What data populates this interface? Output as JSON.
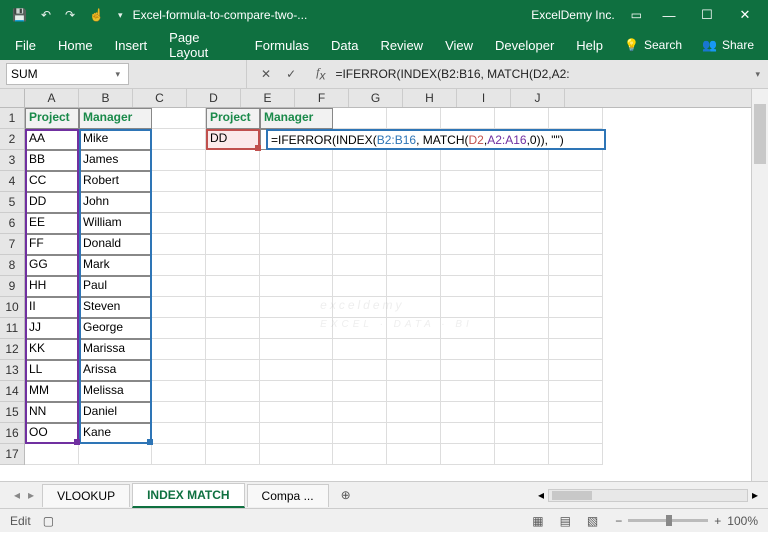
{
  "titlebar": {
    "filename": "Excel-formula-to-compare-two-...",
    "org": "ExcelDemy Inc.",
    "icons": [
      "save",
      "undo",
      "redo",
      "touch"
    ]
  },
  "ribbon": {
    "tabs": [
      "File",
      "Home",
      "Insert",
      "Page Layout",
      "Formulas",
      "Data",
      "Review",
      "View",
      "Developer",
      "Help"
    ],
    "search": "Search",
    "share": "Share"
  },
  "namebox": "SUM",
  "formula_bar": "=IFERROR(INDEX(B2:B16, MATCH(D2,A2:",
  "columns": [
    "A",
    "B",
    "C",
    "D",
    "E",
    "F",
    "G",
    "H",
    "I",
    "J"
  ],
  "rows": [
    1,
    2,
    3,
    4,
    5,
    6,
    7,
    8,
    9,
    10,
    11,
    12,
    13,
    14,
    15,
    16,
    17
  ],
  "headers": {
    "a1": "Project",
    "b1": "Manager",
    "d1": "Project",
    "e1": "Manager"
  },
  "data": {
    "col_a": [
      "AA",
      "BB",
      "CC",
      "DD",
      "EE",
      "FF",
      "GG",
      "HH",
      "II",
      "JJ",
      "KK",
      "LL",
      "MM",
      "NN",
      "OO"
    ],
    "col_b": [
      "Mike",
      "James",
      "Robert",
      "John",
      "William",
      "Donald",
      "Mark",
      "Paul",
      "Steven",
      "George",
      "Marissa",
      "Arissa",
      "Melissa",
      "Daniel",
      "Kane"
    ],
    "d2": "DD"
  },
  "editing": {
    "parts": [
      {
        "c": "f-black",
        "t": "=IFERROR("
      },
      {
        "c": "f-black",
        "t": "INDEX("
      },
      {
        "c": "f-blue",
        "t": "B2:B16"
      },
      {
        "c": "f-black",
        "t": ", MATCH("
      },
      {
        "c": "f-red",
        "t": "D2"
      },
      {
        "c": "f-black",
        "t": ","
      },
      {
        "c": "f-purple",
        "t": "A2:A16"
      },
      {
        "c": "f-black",
        "t": ",0)), \"\")"
      }
    ]
  },
  "sheet_tabs": {
    "items": [
      "VLOOKUP",
      "INDEX MATCH",
      "Compa ..."
    ],
    "active": 1
  },
  "status": {
    "mode": "Edit",
    "zoom": "100%"
  },
  "watermark": {
    "main": "exceldemy",
    "sub": "EXCEL · DATA · BI"
  }
}
